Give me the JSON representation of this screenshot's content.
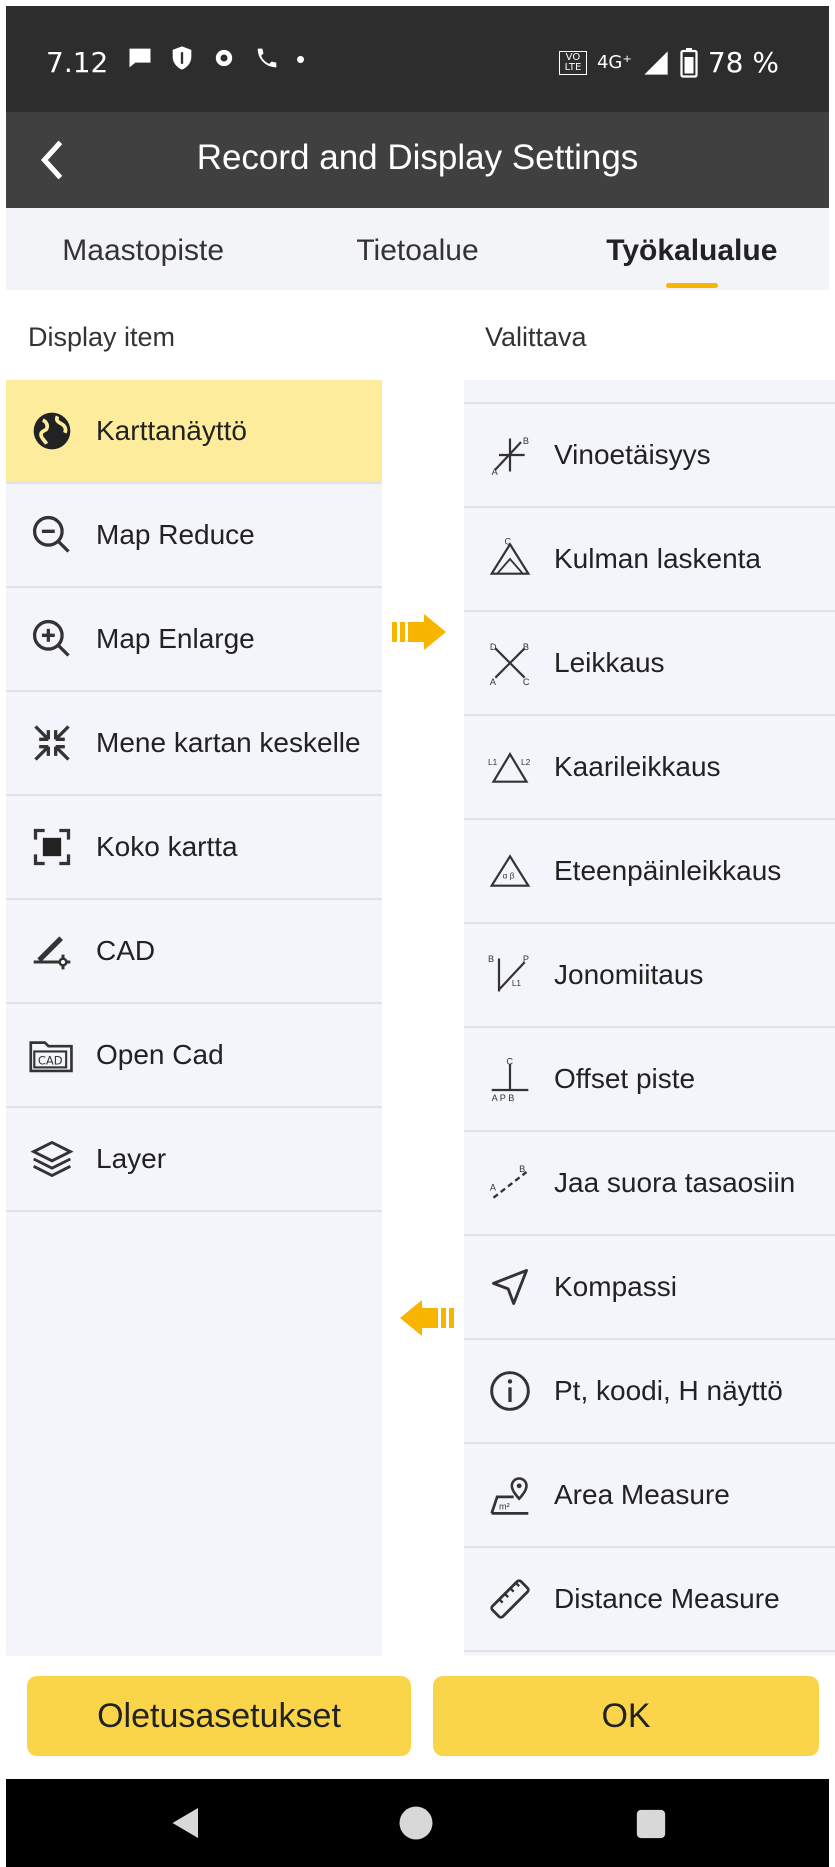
{
  "status_bar": {
    "time": "7.12",
    "network": "4G⁺",
    "volte": "VO LTE",
    "battery": "78 %"
  },
  "app_bar": {
    "title": "Record and Display Settings",
    "back_icon": "chevron-left-icon"
  },
  "tabs": [
    {
      "label": "Maastopiste",
      "active": false
    },
    {
      "label": "Tietoalue",
      "active": false
    },
    {
      "label": "Työkalualue",
      "active": true
    }
  ],
  "columns": {
    "left_header": "Display item",
    "right_header": "Valittava"
  },
  "display_items": [
    {
      "label": "Karttanäyttö",
      "icon": "globe-icon",
      "selected": true
    },
    {
      "label": "Map Reduce",
      "icon": "zoom-out-icon",
      "selected": false
    },
    {
      "label": "Map Enlarge",
      "icon": "zoom-in-icon",
      "selected": false
    },
    {
      "label": "Mene kartan keskelle",
      "icon": "center-map-icon",
      "selected": false
    },
    {
      "label": "Koko kartta",
      "icon": "full-extent-icon",
      "selected": false
    },
    {
      "label": "CAD",
      "icon": "cad-draw-icon",
      "selected": false
    },
    {
      "label": "Open Cad",
      "icon": "open-cad-folder-icon",
      "selected": false
    },
    {
      "label": "Layer",
      "icon": "layers-icon",
      "selected": false
    }
  ],
  "available_items": [
    {
      "label": "Vinoetäisyys",
      "icon": "slope-distance-icon"
    },
    {
      "label": "Kulman laskenta",
      "icon": "angle-calc-icon"
    },
    {
      "label": "Leikkaus",
      "icon": "intersection-icon"
    },
    {
      "label": "Kaarileikkaus",
      "icon": "arc-intersection-icon"
    },
    {
      "label": "Eteenpäinleikkaus",
      "icon": "forward-intersection-icon"
    },
    {
      "label": "Jonomiitaus",
      "icon": "offset-line-icon"
    },
    {
      "label": "Offset piste",
      "icon": "offset-point-icon"
    },
    {
      "label": "Jaa suora tasaosiin",
      "icon": "divide-line-icon"
    },
    {
      "label": "Kompassi",
      "icon": "compass-icon"
    },
    {
      "label": "Pt, koodi, H näyttö",
      "icon": "info-icon"
    },
    {
      "label": "Area Measure",
      "icon": "area-measure-icon"
    },
    {
      "label": "Distance Measure",
      "icon": "ruler-icon"
    }
  ],
  "buttons": {
    "defaults": "Oletusasetukset",
    "ok": "OK"
  },
  "colors": {
    "accent": "#f7b500",
    "button": "#fad54a",
    "selected_row": "#fcec9c"
  }
}
